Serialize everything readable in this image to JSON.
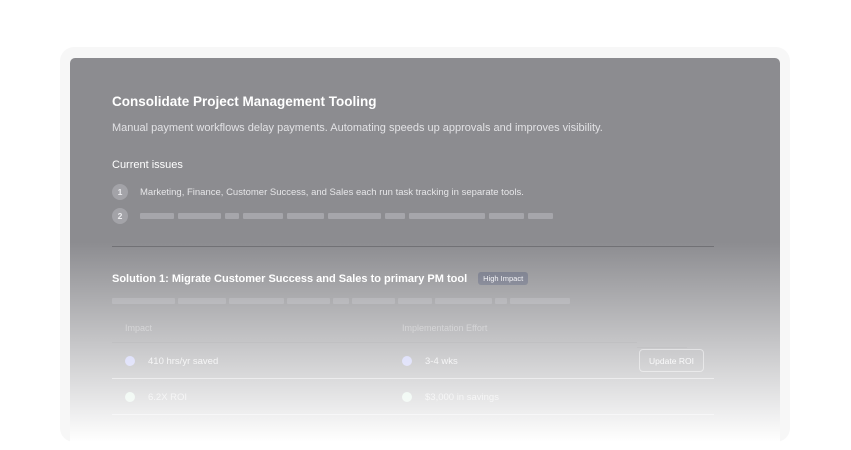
{
  "card": {
    "title": "Consolidate Project Management Tooling",
    "subtitle": "Manual payment workflows delay payments. Automating speeds up approvals and improves visibility."
  },
  "issues": {
    "heading": "Current issues",
    "items": [
      {
        "number": "1",
        "text": "Marketing, Finance, Customer Success, and Sales each run task tracking in separate tools."
      },
      {
        "number": "2",
        "text": ""
      }
    ]
  },
  "solution": {
    "title": "Solution 1: Migrate Customer Success and Sales to primary PM tool",
    "badge": "High Impact",
    "columns": {
      "impact": "Impact",
      "effort": "Implementation Effort"
    },
    "rows": [
      {
        "impact": "410 hrs/yr saved",
        "effort": "3-4 wks",
        "impact_icon": "purple-dot-icon",
        "effort_icon": "purple-dot-icon"
      },
      {
        "impact": "6.2X ROI",
        "effort": "$3,000 in savings",
        "impact_icon": "green-dot-icon",
        "effort_icon": "green-dot-icon"
      }
    ],
    "action_label": "Update ROI"
  },
  "colors": {
    "overlay": "#8c8c90",
    "badge": "#6b6f80",
    "purple_dot": "#b8bcf5",
    "green_dot": "#cbe9d6"
  }
}
